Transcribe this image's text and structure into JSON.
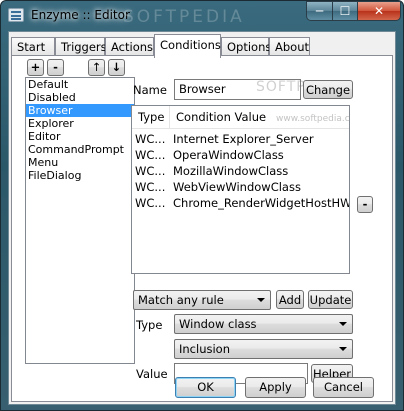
{
  "window": {
    "title": "Enzyme :: Editor",
    "minimize": "─",
    "maximize": "☐",
    "close": "✕"
  },
  "tabs": [
    {
      "label": "Start"
    },
    {
      "label": "Triggers"
    },
    {
      "label": "Actions"
    },
    {
      "label": "Conditions",
      "active": true
    },
    {
      "label": "Options"
    },
    {
      "label": "About"
    }
  ],
  "toolbar": {
    "add": "+",
    "remove": "-",
    "up": "↑",
    "down": "↓"
  },
  "profiles": {
    "items": [
      "Default",
      "Disabled",
      "Browser",
      "Explorer",
      "Editor",
      "CommandPrompt",
      "Menu",
      "FileDialog"
    ],
    "selected": "Browser"
  },
  "name": {
    "label": "Name",
    "value": "Browser",
    "change_button": "Change"
  },
  "conditions_table": {
    "columns": [
      "Type",
      "Condition Value"
    ],
    "rows": [
      {
        "type": "WC...",
        "value": "Internet Explorer_Server"
      },
      {
        "type": "WC...",
        "value": "OperaWindowClass"
      },
      {
        "type": "WC...",
        "value": "MozillaWindowClass"
      },
      {
        "type": "WC...",
        "value": "WebViewWindowClass"
      },
      {
        "type": "WC...",
        "value": "Chrome_RenderWidgetHostHWND"
      }
    ],
    "remove_button": "-"
  },
  "rule": {
    "match_value": "Match any rule",
    "add_button": "Add",
    "update_button": "Update"
  },
  "type_field": {
    "label": "Type",
    "value": "Window class"
  },
  "mode_field": {
    "value": "Inclusion"
  },
  "value_field": {
    "label": "Value",
    "value": "",
    "helper_button": "Helper"
  },
  "footer": {
    "ok": "OK",
    "apply": "Apply",
    "cancel": "Cancel"
  },
  "watermark": {
    "title_text": "SOFTPEDIA",
    "name_text": "SOFTPEDIA",
    "url_text": "www.softpedia.com"
  }
}
